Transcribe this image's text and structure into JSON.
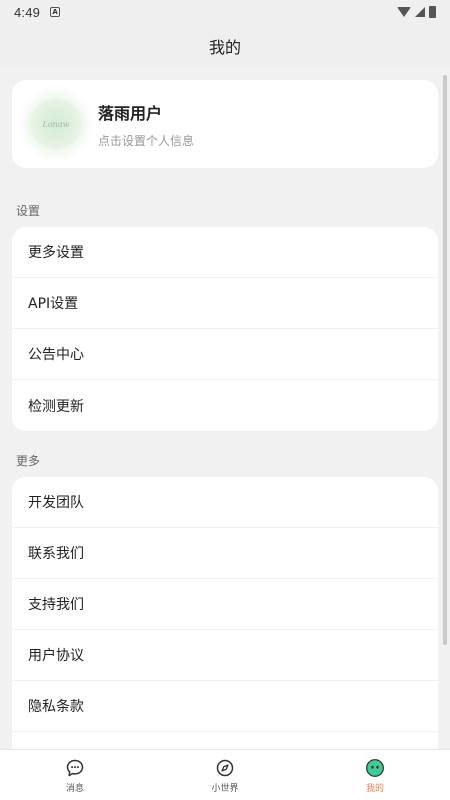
{
  "status": {
    "time": "4:49",
    "notif_glyph": "A"
  },
  "header": {
    "title": "我的"
  },
  "profile": {
    "name": "落雨用户",
    "subtitle": "点击设置个人信息",
    "avatar_text": "Lonaw"
  },
  "settings": {
    "title": "设置",
    "items": [
      {
        "label": "更多设置"
      },
      {
        "label": "API设置"
      },
      {
        "label": "公告中心"
      },
      {
        "label": "检测更新"
      }
    ]
  },
  "more": {
    "title": "更多",
    "items": [
      {
        "label": "开发团队"
      },
      {
        "label": "联系我们"
      },
      {
        "label": "支持我们"
      },
      {
        "label": "用户协议"
      },
      {
        "label": "隐私条款"
      },
      {
        "label": ""
      }
    ]
  },
  "tabbar": {
    "items": [
      {
        "label": "消息",
        "icon": "chat-bubble-icon"
      },
      {
        "label": "小世界",
        "icon": "compass-icon"
      },
      {
        "label": "我的",
        "icon": "smiley-icon",
        "active": true
      }
    ]
  },
  "colors": {
    "accent": "#f07c4c",
    "active_icon": "#3ecb95",
    "background": "#f1f1f1"
  }
}
